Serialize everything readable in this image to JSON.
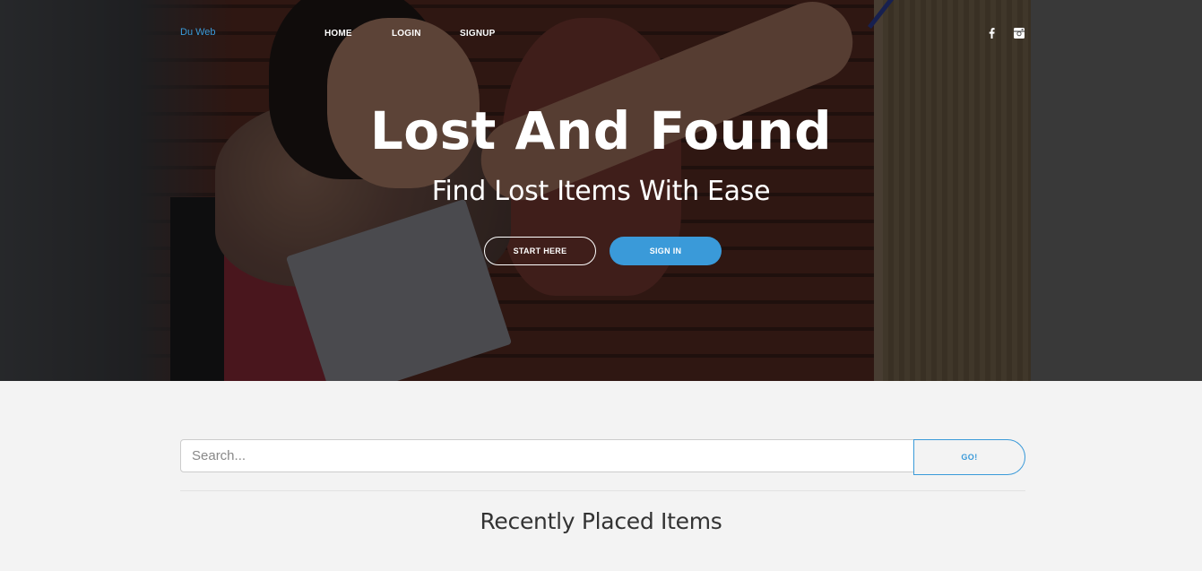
{
  "nav": {
    "brand": "Du Web",
    "links": [
      "HOME",
      "LOGIN",
      "SIGNUP"
    ],
    "social": [
      "facebook-icon",
      "instagram-icon"
    ]
  },
  "hero": {
    "title": "Lost And Found",
    "subtitle": "Find Lost Items With Ease",
    "start_label": "START HERE",
    "signin_label": "SIGN IN"
  },
  "search": {
    "placeholder": "Search...",
    "value": "",
    "button_label": "GO!"
  },
  "section": {
    "title": "Recently Placed Items"
  },
  "colors": {
    "accent": "#3a9ad9",
    "page_bg": "#f3f3f3",
    "overlay": "rgba(0,0,0,0.48)"
  }
}
